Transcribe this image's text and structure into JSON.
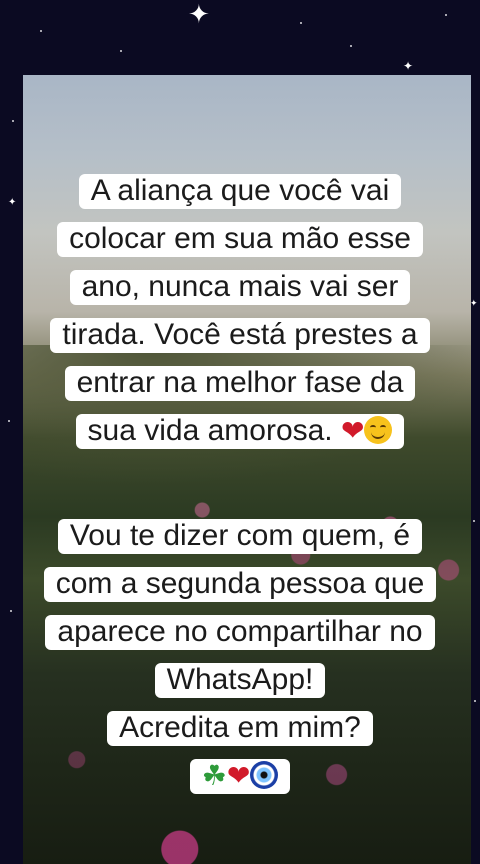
{
  "caption1": {
    "lines": [
      "A aliança que você vai",
      "colocar em sua mão esse",
      "ano, nunca mais vai ser",
      "tirada. Você está prestes a",
      "entrar na melhor fase da",
      "sua vida amorosa."
    ],
    "emojis": [
      "heart-icon",
      "smiling-face-icon"
    ]
  },
  "caption2": {
    "lines": [
      "Vou te dizer com quem, é",
      "com a segunda pessoa que",
      "aparece no compartilhar no",
      "WhatsApp!",
      "Acredita em mim?"
    ],
    "emojis": [
      "four-leaf-clover-icon",
      "heart-icon",
      "nazar-amulet-icon"
    ]
  },
  "colors": {
    "frame": "#0b0a22",
    "highlight": "#ffffff",
    "heart": "#d11a2a",
    "clover": "#2e9b3a"
  }
}
